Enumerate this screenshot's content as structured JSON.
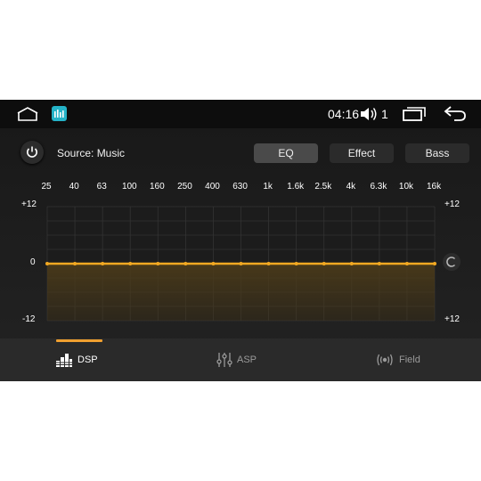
{
  "status_bar": {
    "time": "04:16",
    "volume_level": "1",
    "icons": [
      "home-icon",
      "equalizer-app-icon",
      "volume-icon",
      "recent-apps-icon",
      "back-icon"
    ]
  },
  "controls": {
    "source_label": "Source: Music",
    "buttons": [
      {
        "label": "EQ",
        "active": true
      },
      {
        "label": "Effect",
        "active": false
      },
      {
        "label": "Bass",
        "active": false
      }
    ]
  },
  "chart_data": {
    "type": "line",
    "x": [
      "25",
      "40",
      "63",
      "100",
      "160",
      "250",
      "400",
      "630",
      "1k",
      "1.6k",
      "2.5k",
      "4k",
      "6.3k",
      "10k",
      "16k"
    ],
    "series": [
      {
        "values": [
          0,
          0,
          0,
          0,
          0,
          0,
          0,
          0,
          0,
          0,
          0,
          0,
          0,
          0,
          0
        ]
      }
    ],
    "ylim": [
      -12,
      12
    ],
    "y_left_labels": [
      "+12",
      "0",
      "-12"
    ],
    "y_right_labels": [
      "+12",
      "+12"
    ],
    "grid": true,
    "line_color": "#f2a922",
    "fill_color": "#4a3a1a"
  },
  "tabs": [
    {
      "label": "DSP",
      "icon": "dsp-bars-icon",
      "active": true
    },
    {
      "label": "ASP",
      "icon": "sliders-icon",
      "active": false
    },
    {
      "label": "Field",
      "icon": "sound-field-icon",
      "active": false
    }
  ],
  "accent_color": "#f0a030"
}
